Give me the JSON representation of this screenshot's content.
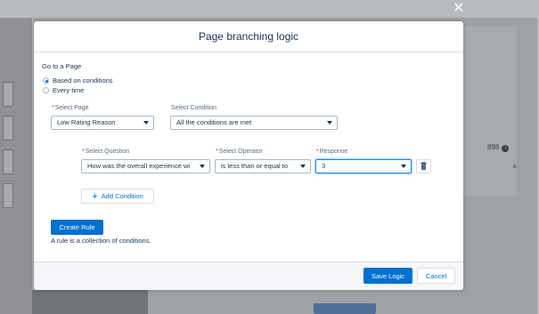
{
  "modal": {
    "title": "Page branching logic"
  },
  "go_to": {
    "heading": "Go to a Page",
    "options": [
      {
        "label": "Based on conditions",
        "selected": true
      },
      {
        "label": "Every time",
        "selected": false
      }
    ]
  },
  "select_page": {
    "label": "Select Page",
    "value": "Low Rating Reason"
  },
  "select_condition": {
    "label": "Select Condition",
    "value": "All the conditions are met"
  },
  "condition_row": {
    "question_label": "Select Question",
    "question_value": "How was the overall experience wi",
    "operator_label": "Select Operator",
    "operator_value": "is less than or equal to",
    "response_label": "Response",
    "response_value": "3"
  },
  "add_condition_label": "Add Condition",
  "create_rule_label": "Create Rule",
  "rule_help_text": "A rule is a collection of conditions.",
  "footer": {
    "save_label": "Save Logic",
    "cancel_label": "Cancel"
  },
  "background": {
    "counter": "898"
  },
  "colors": {
    "brand": "#0070d2",
    "required": "#c23934",
    "text": "#16325c"
  }
}
